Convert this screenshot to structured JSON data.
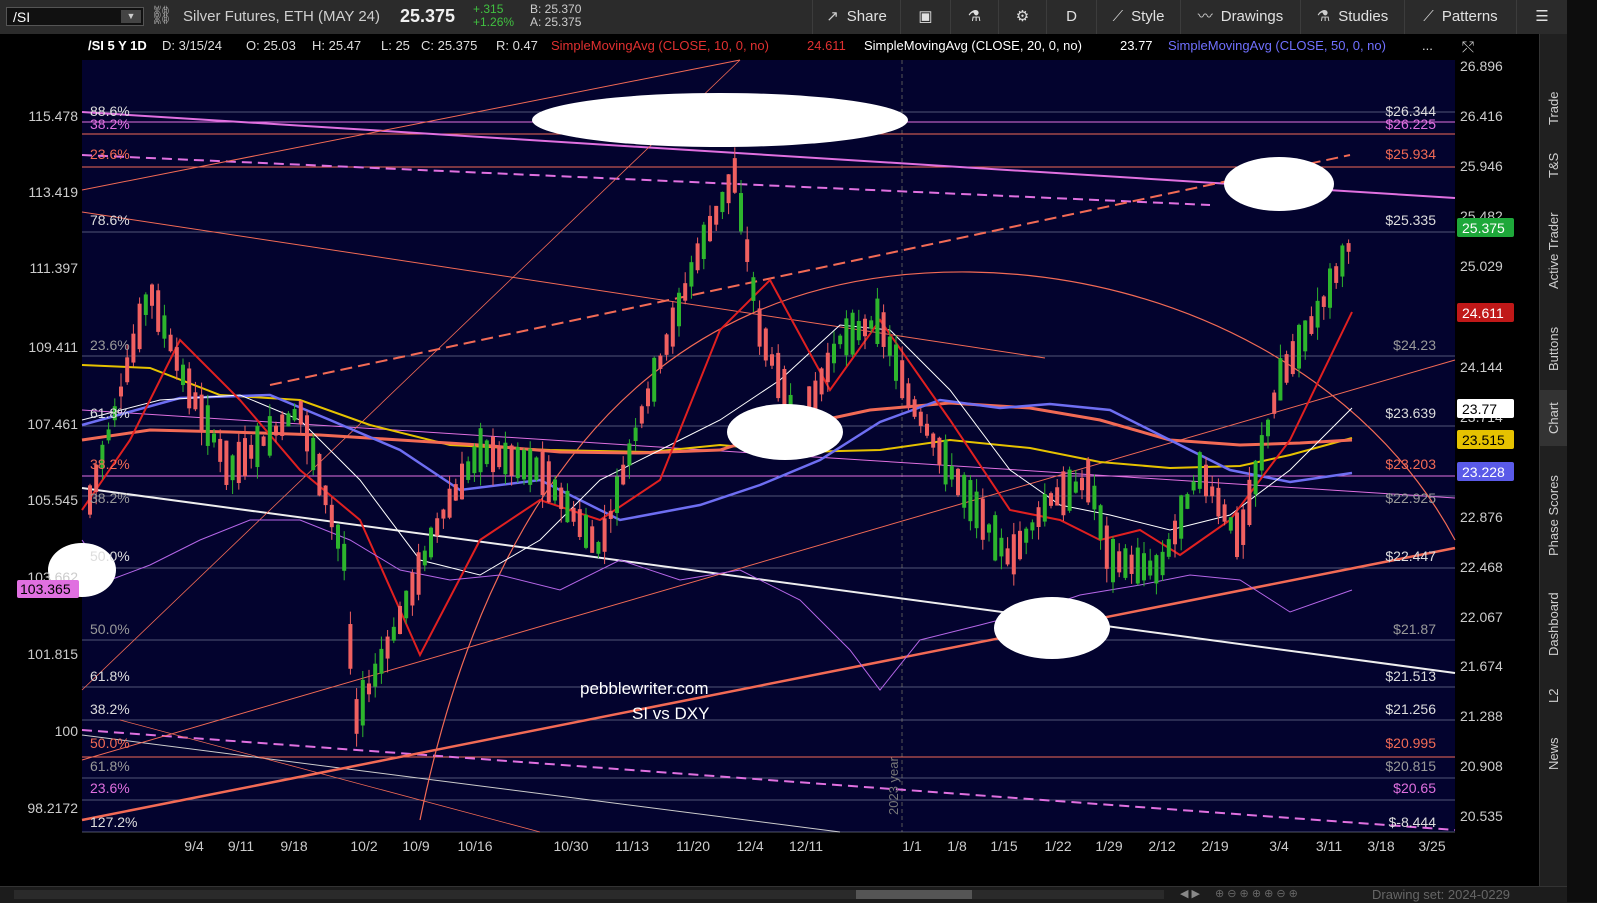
{
  "toolbar": {
    "symbol": "/SI",
    "instrument": "Silver Futures, ETH (MAY 24)",
    "price": "25.375",
    "change": "+.315",
    "change_pct": "+1.26%",
    "bid": "B: 25.370",
    "ask": "A: 25.375",
    "share_label": "Share",
    "timeframe": "D",
    "style_label": "Style",
    "drawings_label": "Drawings",
    "studies_label": "Studies",
    "patterns_label": "Patterns"
  },
  "header": {
    "title": "/SI 5 Y 1D",
    "date": "D: 3/15/24",
    "open": "O: 25.03",
    "high": "H: 25.47",
    "low": "L: 25",
    "close": "C: 25.375",
    "range": "R: 0.47",
    "sma10": "SimpleMovingAvg (CLOSE, 10, 0, no)",
    "sma10_val": "24.611",
    "sma20": "SimpleMovingAvg (CLOSE, 20, 0, no)",
    "sma20_val": "23.77",
    "sma50": "SimpleMovingAvg (CLOSE, 50, 0, no)",
    "more": "..."
  },
  "axis_right": [
    "26.896",
    "26.416",
    "25.946",
    "25.482",
    "25.029",
    "24.144",
    "23.714",
    "22.876",
    "22.468",
    "22.067",
    "21.674",
    "21.288",
    "20.908",
    "20.535"
  ],
  "axis_left": [
    "115.478",
    "113.419",
    "111.397",
    "109.411",
    "107.461",
    "105.545",
    "103.662",
    "101.815",
    "100",
    "98.2172"
  ],
  "x_labels": [
    "9/4",
    "9/11",
    "9/18",
    "10/2",
    "10/9",
    "10/16",
    "10/30",
    "11/13",
    "11/20",
    "12/4",
    "12/11",
    "1/1",
    "1/8",
    "1/15",
    "1/22",
    "1/29",
    "2/12",
    "2/19",
    "3/4",
    "3/11",
    "3/18",
    "3/25"
  ],
  "fib_left": [
    "88.6%",
    "38.2%",
    "23.6%",
    "78.6%",
    "23.6%",
    "61.8%",
    "38.2%",
    "38.2%",
    "50.0%",
    "50.0%",
    "61.8%",
    "38.2%",
    "50.0%",
    "61.8%",
    "23.6%",
    "127.2%"
  ],
  "fib_right": [
    "$26.344",
    "$26.225",
    "$25.934",
    "$25.335",
    "$24.23",
    "$23.639",
    "$23.203",
    "$22.925",
    "$22.447",
    "$21.87",
    "$21.513",
    "$21.256",
    "$20.995",
    "$20.815",
    "$20.65",
    "$-8.444"
  ],
  "badges": {
    "price": "25.375",
    "sma10": "24.611",
    "sma20": "23.77",
    "sma50_yellow": "23.515",
    "sma50": "23.228",
    "dxy": "103.365"
  },
  "watermark": "pebblewriter.com",
  "watermark2": "SI vs DXY",
  "year_label": "2023 year",
  "drawing_set": "Drawing set: 2024-0229",
  "side_tabs": [
    "Trade",
    "T&S",
    "Active Trader",
    "Buttons",
    "Chart",
    "Phase Scores",
    "Dashboard",
    "L2",
    "News"
  ],
  "colors": {
    "bg": "#03032e",
    "up": "#2db52d",
    "down": "#f06060",
    "magenta": "#e070e0",
    "orange": "#f26a55",
    "white": "#ffffff",
    "purple": "#b566e8",
    "yellow": "#e6c200"
  }
}
